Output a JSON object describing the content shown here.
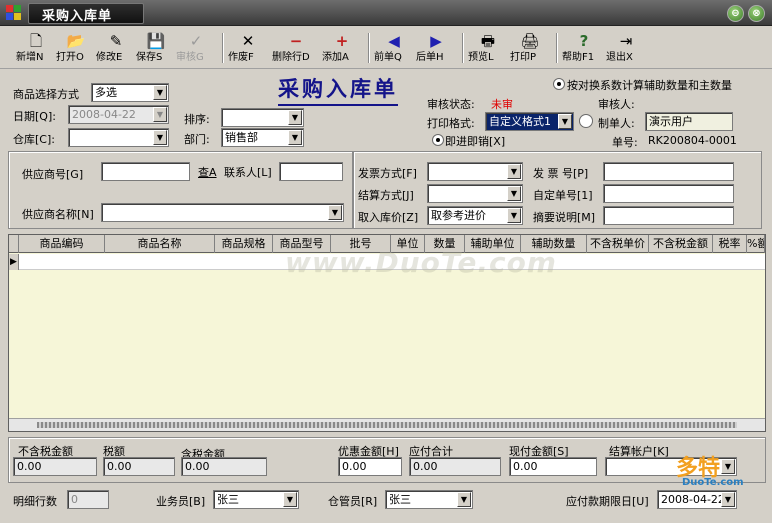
{
  "window": {
    "title": "采购入库单",
    "min_label": "⊖",
    "close_label": "⊗"
  },
  "toolbar": [
    {
      "label": "新增N",
      "icon": "new-doc-icon",
      "glyph": "🗋"
    },
    {
      "label": "打开O",
      "icon": "open-icon",
      "glyph": "📂"
    },
    {
      "label": "修改E",
      "icon": "edit-icon",
      "glyph": "✎"
    },
    {
      "label": "保存S",
      "icon": "save-icon",
      "glyph": "💾"
    },
    {
      "label": "审核G",
      "icon": "audit-icon",
      "glyph": "✓",
      "disabled": true
    },
    {
      "label": "作废F",
      "icon": "void-icon",
      "glyph": "✕"
    },
    {
      "label": "删除行D",
      "icon": "delete-row-icon",
      "glyph": "−"
    },
    {
      "label": "添加A",
      "icon": "add-icon",
      "glyph": "+"
    },
    {
      "label": "前单Q",
      "icon": "prev-icon",
      "glyph": "◀"
    },
    {
      "label": "后单H",
      "icon": "next-icon",
      "glyph": "▶"
    },
    {
      "label": "预览L",
      "icon": "preview-icon",
      "glyph": "🖶"
    },
    {
      "label": "打印P",
      "icon": "print-icon",
      "glyph": "🖨"
    },
    {
      "label": "帮助F1",
      "icon": "help-icon",
      "glyph": "?"
    },
    {
      "label": "退出X",
      "icon": "exit-icon",
      "glyph": "⇥"
    }
  ],
  "form": {
    "doc_title": "采购入库单",
    "product_select_label": "商品选择方式",
    "product_select_value": "多选",
    "date_label": "日期[Q]:",
    "date_value": "2008-04-22",
    "warehouse_label": "仓库[C]:",
    "sort_label": "排序:",
    "dept_label": "部门:",
    "dept_value": "销售部",
    "audit_status_label": "审核状态:",
    "audit_status_value": "未审",
    "auditor_label": "审核人:",
    "print_format_label": "打印格式:",
    "print_format_value": "自定义格式1",
    "maker_label": "制单人:",
    "maker_value": "演示用户",
    "print_cancel_label": "即进即销[X]",
    "doc_no_label": "单号:",
    "doc_no_value": "RK200804-0001",
    "convert_checkbox_label": "按对换系数计算辅助数量和主数量"
  },
  "supplier": {
    "supplier_no_label": "供应商号[G]",
    "lookup_label": "查A",
    "contact_label": "联系人[L]",
    "supplier_name_label": "供应商名称[N]"
  },
  "invoice": {
    "invoice_method_label": "发票方式[F]",
    "invoice_no_label": "发 票 号[P]",
    "settle_method_label": "结算方式[J]",
    "custom_no_label": "自定单号[1]",
    "stock_price_label": "取入库价[Z]",
    "stock_price_value": "取参考进价",
    "summary_label": "摘要说明[M]"
  },
  "grid": {
    "columns": [
      "商品编码",
      "商品名称",
      "商品规格",
      "商品型号",
      "批号",
      "单位",
      "数量",
      "辅助单位",
      "辅助数量",
      "不含税单价",
      "不含税金额",
      "税率",
      "%额"
    ]
  },
  "totals": {
    "untaxed_label": "不含税金额",
    "untaxed_value": "0.00",
    "tax_label": "税额",
    "tax_value": "0.00",
    "taxed_label": "含税金额",
    "taxed_value": "0.00",
    "discount_label": "优惠金额[H]",
    "discount_value": "0.00",
    "payable_label": "应付合计",
    "payable_value": "0.00",
    "cash_label": "现付金额[S]",
    "cash_value": "0.00",
    "account_label": "结算帐户[K]"
  },
  "footer": {
    "rows_label": "明细行数",
    "rows_value": "0",
    "clerk_label": "业务员[B]",
    "clerk_value": "张三",
    "keeper_label": "仓管员[R]",
    "keeper_value": "张三",
    "due_label": "应付款期限日[U]",
    "due_value": "2008-04-22"
  },
  "watermark": "www.DuoTe.com",
  "brand": {
    "name": "多特",
    "site": "DuoTe.com"
  }
}
